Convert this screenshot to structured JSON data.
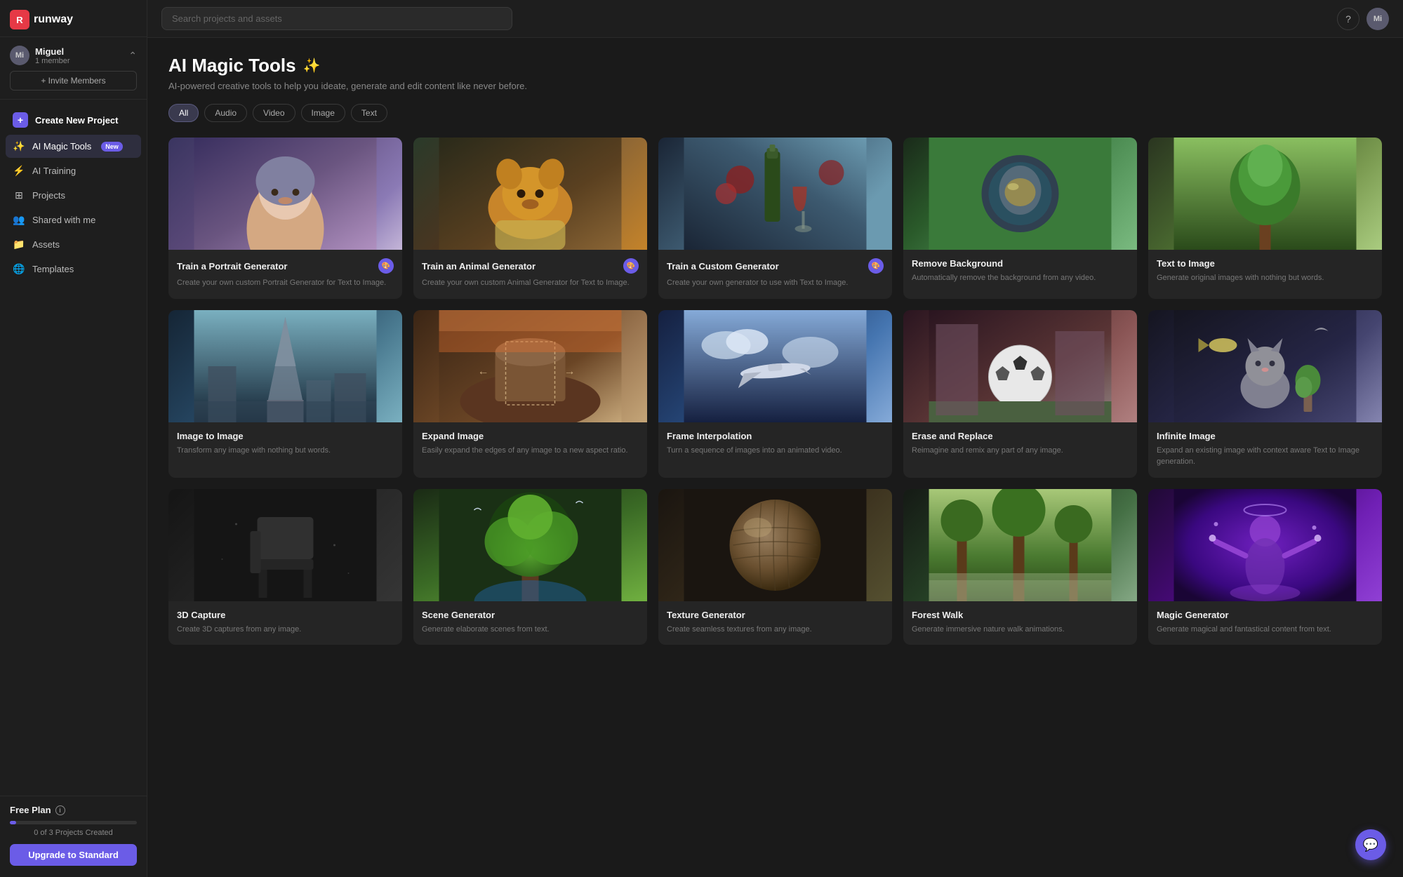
{
  "app": {
    "name": "runway"
  },
  "user": {
    "name": "Miguel",
    "members": "1 member",
    "initials": "Mi"
  },
  "sidebar": {
    "invite_label": "+ Invite Members",
    "nav_items": [
      {
        "id": "create-project",
        "label": "Create New Project",
        "icon": "➕",
        "type": "create"
      },
      {
        "id": "ai-magic-tools",
        "label": "AI Magic Tools",
        "icon": "✨",
        "badge": "New",
        "active": true
      },
      {
        "id": "ai-training",
        "label": "AI Training",
        "icon": "⚡"
      },
      {
        "id": "projects",
        "label": "Projects",
        "icon": "🗂"
      },
      {
        "id": "shared-with-me",
        "label": "Shared with me",
        "icon": "👥"
      },
      {
        "id": "assets",
        "label": "Assets",
        "icon": "📁"
      },
      {
        "id": "templates",
        "label": "Templates",
        "icon": "🌐"
      }
    ],
    "footer": {
      "plan": "Free Plan",
      "info_tooltip": "Info",
      "progress_pct": 5,
      "projects_created": "0 of 3 Projects Created",
      "upgrade_label": "Upgrade to Standard"
    }
  },
  "topbar": {
    "search_placeholder": "Search projects and assets",
    "help_icon": "?",
    "user_initials": "Mi"
  },
  "main": {
    "title": "AI Magic Tools",
    "sparkle": "✨",
    "subtitle": "AI-powered creative tools to help you ideate, generate and edit content like never before.",
    "filters": [
      {
        "id": "all",
        "label": "All",
        "active": true
      },
      {
        "id": "audio",
        "label": "Audio",
        "active": false
      },
      {
        "id": "video",
        "label": "Video",
        "active": false
      },
      {
        "id": "image",
        "label": "Image",
        "active": false
      },
      {
        "id": "text",
        "label": "Text",
        "active": false
      }
    ],
    "tools": [
      {
        "id": "train-portrait",
        "title": "Train a Portrait Generator",
        "description": "Create your own custom Portrait Generator for Text to Image.",
        "has_badge": true,
        "thumb_style": "portrait",
        "thumb_emoji": "🧑‍🎨"
      },
      {
        "id": "train-animal",
        "title": "Train an Animal Generator",
        "description": "Create your own custom Animal Generator for Text to Image.",
        "has_badge": true,
        "thumb_style": "animal",
        "thumb_emoji": "🐕"
      },
      {
        "id": "train-custom",
        "title": "Train a Custom Generator",
        "description": "Create your own generator to use with Text to Image.",
        "has_badge": true,
        "thumb_style": "custom",
        "thumb_emoji": "🍷"
      },
      {
        "id": "remove-background",
        "title": "Remove Background",
        "description": "Automatically remove the background from any video.",
        "has_badge": false,
        "thumb_style": "remove-bg",
        "thumb_emoji": "🪖"
      },
      {
        "id": "text-to-image",
        "title": "Text to Image",
        "description": "Generate original images with nothing but words.",
        "has_badge": false,
        "thumb_style": "text-to-image",
        "thumb_emoji": "🌳"
      },
      {
        "id": "image-to-image",
        "title": "Image to Image",
        "description": "Transform any image with nothing but words.",
        "has_badge": false,
        "thumb_style": "img-to-img",
        "thumb_emoji": "🗼"
      },
      {
        "id": "expand-image",
        "title": "Expand Image",
        "description": "Easily expand the edges of any image to a new aspect ratio.",
        "has_badge": false,
        "thumb_style": "expand",
        "thumb_emoji": "🏜"
      },
      {
        "id": "frame-interpolation",
        "title": "Frame Interpolation",
        "description": "Turn a sequence of images into an animated video.",
        "has_badge": false,
        "thumb_style": "frame-interp",
        "thumb_emoji": "✈"
      },
      {
        "id": "erase-and-replace",
        "title": "Erase and Replace",
        "description": "Reimagine and remix any part of any image.",
        "has_badge": false,
        "thumb_style": "erase",
        "thumb_emoji": "⚽"
      },
      {
        "id": "infinite-image",
        "title": "Infinite Image",
        "description": "Expand an existing image with context aware Text to Image generation.",
        "has_badge": false,
        "thumb_style": "infinite",
        "thumb_emoji": "🐱"
      },
      {
        "id": "tool-11",
        "title": "3D Capture",
        "description": "Create 3D captures from any image.",
        "has_badge": false,
        "thumb_style": "chair",
        "thumb_emoji": "🪑"
      },
      {
        "id": "tool-12",
        "title": "Scene Generator",
        "description": "Generate elaborate scenes from text.",
        "has_badge": false,
        "thumb_style": "tree",
        "thumb_emoji": "🌳"
      },
      {
        "id": "tool-13",
        "title": "Texture Generator",
        "description": "Create seamless textures from any image.",
        "has_badge": false,
        "thumb_style": "sphere",
        "thumb_emoji": "🌐"
      },
      {
        "id": "tool-14",
        "title": "Forest Walk",
        "description": "Generate immersive nature walk animations.",
        "has_badge": false,
        "thumb_style": "forest",
        "thumb_emoji": "🌲"
      },
      {
        "id": "tool-15",
        "title": "Magic Generator",
        "description": "Generate magical and fantastical content from text.",
        "has_badge": false,
        "thumb_style": "purple",
        "thumb_emoji": "🔮"
      }
    ]
  }
}
